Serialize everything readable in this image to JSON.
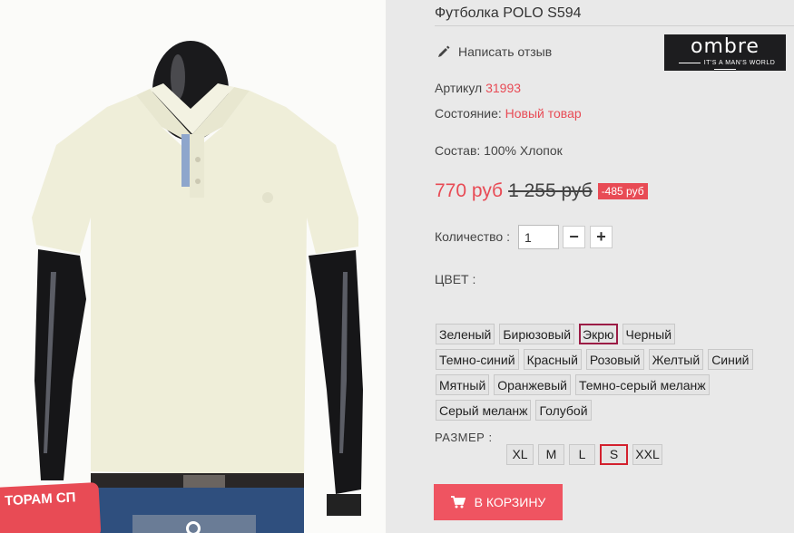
{
  "product": {
    "title": "Футболка POLO S594",
    "review_link": "Написать отзыв",
    "brand": {
      "name": "ombre",
      "tagline": "IT'S A MAN'S WORLD"
    },
    "sku_label": "Артикул",
    "sku_value": "31993",
    "condition_label": "Состояние:",
    "condition_value": "Новый товар",
    "composition": "Состав: 100% Хлопок",
    "price": "770 руб",
    "old_price": "1 255 руб",
    "discount": "-485 руб",
    "quantity_label": "Количество :",
    "quantity_value": "1",
    "qty_minus": "−",
    "qty_plus": "+",
    "color_label": "ЦВЕТ :",
    "colors": [
      {
        "label": "Зеленый",
        "selected": false
      },
      {
        "label": "Бирюзовый",
        "selected": false
      },
      {
        "label": "Экрю",
        "selected": true
      },
      {
        "label": "Черный",
        "selected": false
      },
      {
        "label": "Темно-синий",
        "selected": false
      },
      {
        "label": "Красный",
        "selected": false
      },
      {
        "label": "Розовый",
        "selected": false
      },
      {
        "label": "Желтый",
        "selected": false
      },
      {
        "label": "Синий",
        "selected": false
      },
      {
        "label": "Мятный",
        "selected": false
      },
      {
        "label": "Оранжевый",
        "selected": false
      },
      {
        "label": "Темно-серый меланж",
        "selected": false
      },
      {
        "label": "Серый меланж",
        "selected": false
      },
      {
        "label": "Голубой",
        "selected": false
      }
    ],
    "size_label": "РАЗМЕР :",
    "sizes": [
      {
        "label": "XL",
        "selected": false
      },
      {
        "label": "M",
        "selected": false
      },
      {
        "label": "L",
        "selected": false
      },
      {
        "label": "S",
        "selected": true
      },
      {
        "label": "XXL",
        "selected": false
      }
    ],
    "cart_button": "В КОРЗИНУ",
    "promo_badge": "ТОРАМ СП"
  },
  "colors_theme": {
    "accent": "#e84b55",
    "selected_color_border": "#9b1c45",
    "selected_size_border": "#d3212e"
  },
  "icons": {
    "review": "pencil-icon",
    "cart": "cart-icon",
    "thumb": "zoom-icon"
  }
}
